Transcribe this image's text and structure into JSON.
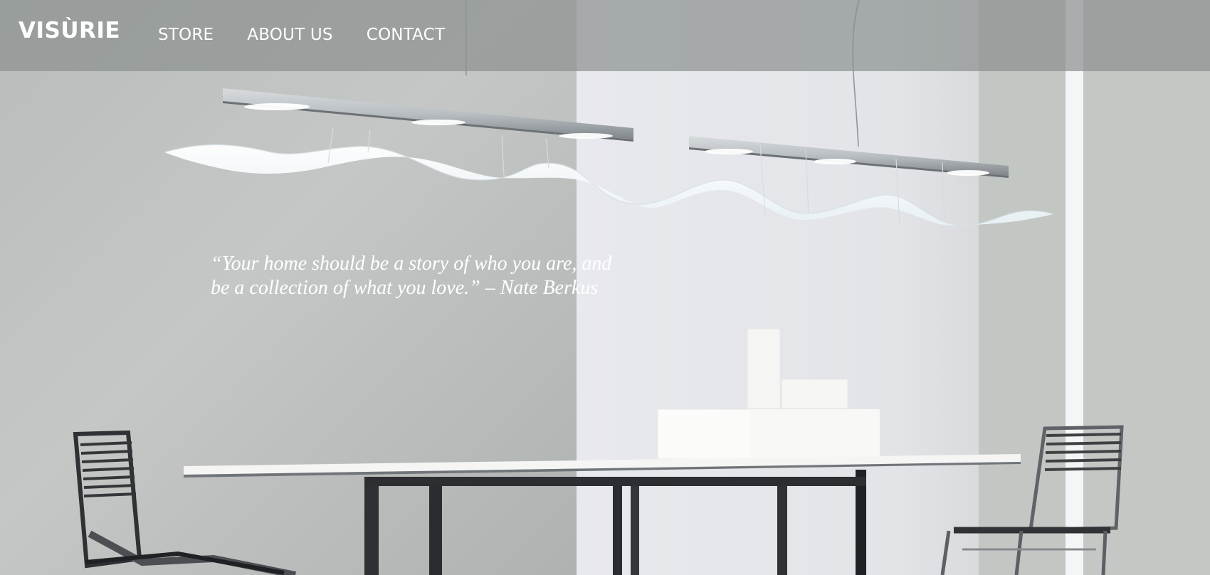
{
  "header": {
    "brand": "VISÙRIE",
    "nav": [
      {
        "label": "STORE"
      },
      {
        "label": "ABOUT US"
      },
      {
        "label": "CONTACT"
      }
    ]
  },
  "hero": {
    "quote": "“Your home should be a story of who you are, and be a collection of what you love.” – Nate Berkus"
  },
  "colors": {
    "header_overlay": "#8c9290",
    "header_text": "#ffffff",
    "quote_text": "#ffffff",
    "background_left": "#b9bcbb",
    "background_center": "#e7e8ec"
  },
  "icons": [
    "pendant-lamp-icon",
    "wave-lamp-shade-icon",
    "chair-icon",
    "table-icon",
    "box-decor-icon"
  ]
}
